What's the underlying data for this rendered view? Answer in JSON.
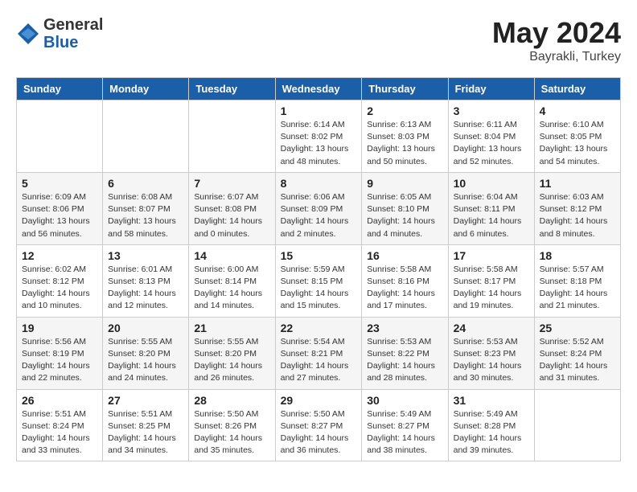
{
  "logo": {
    "general": "General",
    "blue": "Blue"
  },
  "header": {
    "month_year": "May 2024",
    "location": "Bayrakli, Turkey"
  },
  "weekdays": [
    "Sunday",
    "Monday",
    "Tuesday",
    "Wednesday",
    "Thursday",
    "Friday",
    "Saturday"
  ],
  "weeks": [
    [
      null,
      null,
      null,
      {
        "day": 1,
        "sunrise": "6:14 AM",
        "sunset": "8:02 PM",
        "daylight": "13 hours and 48 minutes."
      },
      {
        "day": 2,
        "sunrise": "6:13 AM",
        "sunset": "8:03 PM",
        "daylight": "13 hours and 50 minutes."
      },
      {
        "day": 3,
        "sunrise": "6:11 AM",
        "sunset": "8:04 PM",
        "daylight": "13 hours and 52 minutes."
      },
      {
        "day": 4,
        "sunrise": "6:10 AM",
        "sunset": "8:05 PM",
        "daylight": "13 hours and 54 minutes."
      }
    ],
    [
      {
        "day": 5,
        "sunrise": "6:09 AM",
        "sunset": "8:06 PM",
        "daylight": "13 hours and 56 minutes."
      },
      {
        "day": 6,
        "sunrise": "6:08 AM",
        "sunset": "8:07 PM",
        "daylight": "13 hours and 58 minutes."
      },
      {
        "day": 7,
        "sunrise": "6:07 AM",
        "sunset": "8:08 PM",
        "daylight": "14 hours and 0 minutes."
      },
      {
        "day": 8,
        "sunrise": "6:06 AM",
        "sunset": "8:09 PM",
        "daylight": "14 hours and 2 minutes."
      },
      {
        "day": 9,
        "sunrise": "6:05 AM",
        "sunset": "8:10 PM",
        "daylight": "14 hours and 4 minutes."
      },
      {
        "day": 10,
        "sunrise": "6:04 AM",
        "sunset": "8:11 PM",
        "daylight": "14 hours and 6 minutes."
      },
      {
        "day": 11,
        "sunrise": "6:03 AM",
        "sunset": "8:12 PM",
        "daylight": "14 hours and 8 minutes."
      }
    ],
    [
      {
        "day": 12,
        "sunrise": "6:02 AM",
        "sunset": "8:12 PM",
        "daylight": "14 hours and 10 minutes."
      },
      {
        "day": 13,
        "sunrise": "6:01 AM",
        "sunset": "8:13 PM",
        "daylight": "14 hours and 12 minutes."
      },
      {
        "day": 14,
        "sunrise": "6:00 AM",
        "sunset": "8:14 PM",
        "daylight": "14 hours and 14 minutes."
      },
      {
        "day": 15,
        "sunrise": "5:59 AM",
        "sunset": "8:15 PM",
        "daylight": "14 hours and 15 minutes."
      },
      {
        "day": 16,
        "sunrise": "5:58 AM",
        "sunset": "8:16 PM",
        "daylight": "14 hours and 17 minutes."
      },
      {
        "day": 17,
        "sunrise": "5:58 AM",
        "sunset": "8:17 PM",
        "daylight": "14 hours and 19 minutes."
      },
      {
        "day": 18,
        "sunrise": "5:57 AM",
        "sunset": "8:18 PM",
        "daylight": "14 hours and 21 minutes."
      }
    ],
    [
      {
        "day": 19,
        "sunrise": "5:56 AM",
        "sunset": "8:19 PM",
        "daylight": "14 hours and 22 minutes."
      },
      {
        "day": 20,
        "sunrise": "5:55 AM",
        "sunset": "8:20 PM",
        "daylight": "14 hours and 24 minutes."
      },
      {
        "day": 21,
        "sunrise": "5:55 AM",
        "sunset": "8:20 PM",
        "daylight": "14 hours and 26 minutes."
      },
      {
        "day": 22,
        "sunrise": "5:54 AM",
        "sunset": "8:21 PM",
        "daylight": "14 hours and 27 minutes."
      },
      {
        "day": 23,
        "sunrise": "5:53 AM",
        "sunset": "8:22 PM",
        "daylight": "14 hours and 28 minutes."
      },
      {
        "day": 24,
        "sunrise": "5:53 AM",
        "sunset": "8:23 PM",
        "daylight": "14 hours and 30 minutes."
      },
      {
        "day": 25,
        "sunrise": "5:52 AM",
        "sunset": "8:24 PM",
        "daylight": "14 hours and 31 minutes."
      }
    ],
    [
      {
        "day": 26,
        "sunrise": "5:51 AM",
        "sunset": "8:24 PM",
        "daylight": "14 hours and 33 minutes."
      },
      {
        "day": 27,
        "sunrise": "5:51 AM",
        "sunset": "8:25 PM",
        "daylight": "14 hours and 34 minutes."
      },
      {
        "day": 28,
        "sunrise": "5:50 AM",
        "sunset": "8:26 PM",
        "daylight": "14 hours and 35 minutes."
      },
      {
        "day": 29,
        "sunrise": "5:50 AM",
        "sunset": "8:27 PM",
        "daylight": "14 hours and 36 minutes."
      },
      {
        "day": 30,
        "sunrise": "5:49 AM",
        "sunset": "8:27 PM",
        "daylight": "14 hours and 38 minutes."
      },
      {
        "day": 31,
        "sunrise": "5:49 AM",
        "sunset": "8:28 PM",
        "daylight": "14 hours and 39 minutes."
      },
      null
    ]
  ]
}
